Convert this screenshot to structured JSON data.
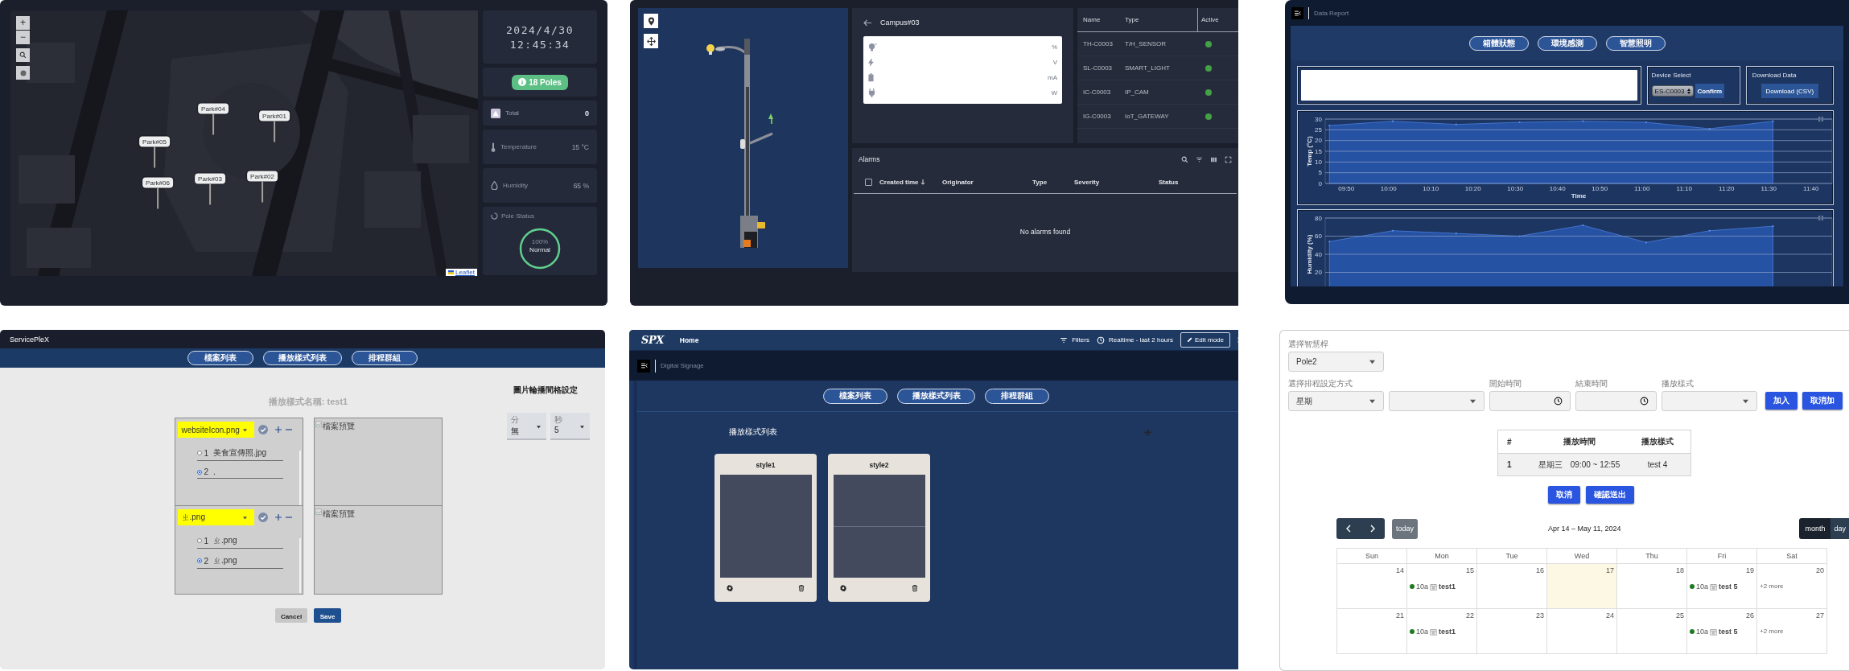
{
  "map_dashboard": {
    "map": {
      "kind": "picture",
      "zoom_in": "+",
      "zoom_out": "−",
      "attribution": "Leaflet",
      "markers": [
        {
          "label": "Park#04"
        },
        {
          "label": "Park#01"
        },
        {
          "label": "Park#05"
        },
        {
          "label": "Park#06"
        },
        {
          "label": "Park#03"
        },
        {
          "label": "Park#02"
        }
      ]
    },
    "clock": {
      "date": "2024/4/30",
      "time": "12:45:34"
    },
    "poles_badge": "18 Poles",
    "stats": [
      {
        "kind": "total",
        "label": "Total",
        "value": "0"
      },
      {
        "kind": "temperature",
        "label": "Temperature",
        "value": "15 °C"
      },
      {
        "kind": "humidity",
        "label": "Humidity",
        "value": "65 %"
      }
    ],
    "pole_status": {
      "title": "Pole Status",
      "percent": "100%",
      "status": "Normal"
    }
  },
  "pole_dashboard": {
    "device": {
      "title": "Campus#03",
      "readings": [
        {
          "kind": "light",
          "unit": "%"
        },
        {
          "kind": "power",
          "unit": "V"
        },
        {
          "kind": "battery",
          "unit": "mA"
        },
        {
          "kind": "plug",
          "unit": "W"
        }
      ]
    },
    "devices": {
      "columns": [
        "Name",
        "Type",
        "Active"
      ],
      "rows": [
        {
          "name": "TH-C0003",
          "type": "T/H_SENSOR",
          "active": true
        },
        {
          "name": "SL-C0003",
          "type": "SMART_LIGHT",
          "active": true
        },
        {
          "name": "IC-C0003",
          "type": "IP_CAM",
          "active": true
        },
        {
          "name": "IG-C0003",
          "type": "IoT_GATEWAY",
          "active": true
        }
      ]
    },
    "alarms": {
      "title": "Alarms",
      "select_all_checked": false,
      "columns": [
        "Created time",
        "Originator",
        "Type",
        "Severity",
        "Status"
      ],
      "empty_text": "No alarms found"
    }
  },
  "data_report": {
    "title": "Data Report",
    "nav_buttons": [
      "箱體狀態",
      "環境感測",
      "智慧照明"
    ],
    "device_select": {
      "title": "Device Select",
      "value": "ES-C0003",
      "confirm": "Confirm"
    },
    "download": {
      "title": "Download Data",
      "button": "Download (CSV)"
    },
    "charts": [
      {
        "chart_data": {
          "type": "area",
          "xlabel": "Time",
          "ylabel": "Temp (°C)",
          "grid": true,
          "x": [
            586,
            601,
            616,
            631,
            646,
            661,
            676,
            691
          ],
          "xlim": [
            585,
            705
          ],
          "ylim": [
            0,
            30
          ],
          "xticks": [
            {
              "value": 590,
              "label": "09:50"
            },
            {
              "value": 600,
              "label": "10:00"
            },
            {
              "value": 610,
              "label": "10:10"
            },
            {
              "value": 620,
              "label": "10:20"
            },
            {
              "value": 630,
              "label": "10:30"
            },
            {
              "value": 640,
              "label": "10:40"
            },
            {
              "value": 650,
              "label": "10:50"
            },
            {
              "value": 660,
              "label": "11:00"
            },
            {
              "value": 670,
              "label": "11:10"
            },
            {
              "value": 680,
              "label": "11:20"
            },
            {
              "value": 690,
              "label": "11:30"
            },
            {
              "value": 700,
              "label": "11:40"
            }
          ],
          "yticks": [
            0,
            5,
            10,
            15,
            20,
            25,
            30
          ],
          "series": [
            {
              "color": "#2652a3",
              "values": [
                27,
                29,
                27.5,
                28.5,
                29,
                28.5,
                25.5,
                29
              ]
            }
          ]
        }
      },
      {
        "chart_data": {
          "type": "area",
          "ylabel": "Humidity (%)",
          "grid": true,
          "x": [
            586,
            601,
            616,
            631,
            646,
            661,
            676,
            691
          ],
          "xlim": [
            585,
            705
          ],
          "ylim": [
            0,
            80
          ],
          "yticks": [
            20,
            40,
            60,
            80
          ],
          "series": [
            {
              "color": "#2652a3",
              "values": [
                54,
                66,
                63,
                60,
                72,
                53,
                66,
                71
              ]
            }
          ]
        }
      }
    ]
  },
  "style_editor": {
    "brand": "ServicePleX",
    "nav_buttons": [
      "檔案列表",
      "播放樣式列表",
      "排程群組"
    ],
    "title": "播放樣式名稱: test1",
    "slots": [
      {
        "file": "websiteIcon.png",
        "preview": "檔案預覽",
        "options": [
          {
            "index": "1",
            "name": "美食宣傳照.jpg",
            "selected": false
          },
          {
            "index": "2",
            "name": ".",
            "selected": true
          }
        ]
      },
      {
        "file": "ㄓ.png",
        "preview": "檔案預覽",
        "options": [
          {
            "index": "1",
            "name": "ㄓ.png",
            "selected": false
          },
          {
            "index": "2",
            "name": "ㄓ.png",
            "selected": true
          }
        ]
      }
    ],
    "cancel": "Cancel",
    "save": "Save",
    "interval": {
      "title": "圖片輪播間格設定",
      "fields": [
        {
          "label": "分",
          "value": "無"
        },
        {
          "label": "秒",
          "value": "5"
        }
      ]
    }
  },
  "signage": {
    "brand": "SPX",
    "home": "Home",
    "filters": "Filters",
    "time_window": "Realtime - last 2 hours",
    "edit_mode": "Edit mode",
    "title": "Digital Signage",
    "nav_buttons": [
      "檔案列表",
      "播放樣式列表",
      "排程群組"
    ],
    "list_title": "播放樣式列表",
    "styles": [
      {
        "name": "style1",
        "kind": "single"
      },
      {
        "name": "style2",
        "kind": "split"
      }
    ]
  },
  "schedule": {
    "pole": {
      "label": "選擇智慧桿",
      "value": "Pole2"
    },
    "fields": [
      {
        "kind": "select",
        "label": "選擇排程設定方式",
        "value": "星期"
      },
      {
        "kind": "select"
      },
      {
        "kind": "time",
        "label": "開始時間"
      },
      {
        "kind": "time",
        "label": "結束時間"
      },
      {
        "kind": "select",
        "label": "播放樣式"
      }
    ],
    "buttons": [
      "加入",
      "取消加"
    ],
    "table": {
      "columns": [
        "#",
        "播放時間",
        "播放樣式"
      ],
      "rows": [
        [
          "1",
          "星期三　09:00 ~ 12:55",
          "test 4"
        ]
      ]
    },
    "actions": [
      "取消",
      "確認送出"
    ],
    "calendar": {
      "range": "Apr 14 – May 11, 2024",
      "today_button": "today",
      "views": [
        {
          "label": "month",
          "selected": true
        },
        {
          "label": "day",
          "selected": false
        }
      ],
      "weekdays": [
        "Sun",
        "Mon",
        "Tue",
        "Wed",
        "Thu",
        "Fri",
        "Sat"
      ],
      "weeks": [
        [
          {
            "day": "14",
            "today": false
          },
          {
            "day": "15",
            "today": false,
            "events": [
              {
                "time": "10a",
                "title": "test1"
              }
            ]
          },
          {
            "day": "16",
            "today": false
          },
          {
            "day": "17",
            "today": true
          },
          {
            "day": "18",
            "today": false
          },
          {
            "day": "19",
            "today": false,
            "events": [
              {
                "time": "10a",
                "title": "test 5"
              }
            ]
          },
          {
            "day": "20",
            "today": false,
            "more": "+2 more"
          }
        ],
        [
          {
            "day": "21",
            "today": false
          },
          {
            "day": "22",
            "today": false,
            "events": [
              {
                "time": "10a",
                "title": "test1"
              }
            ]
          },
          {
            "day": "23",
            "today": false
          },
          {
            "day": "24",
            "today": false
          },
          {
            "day": "25",
            "today": false
          },
          {
            "day": "26",
            "today": false,
            "events": [
              {
                "time": "10a",
                "title": "test 5"
              }
            ]
          },
          {
            "day": "27",
            "today": false,
            "more": "+2 more"
          }
        ]
      ]
    }
  }
}
